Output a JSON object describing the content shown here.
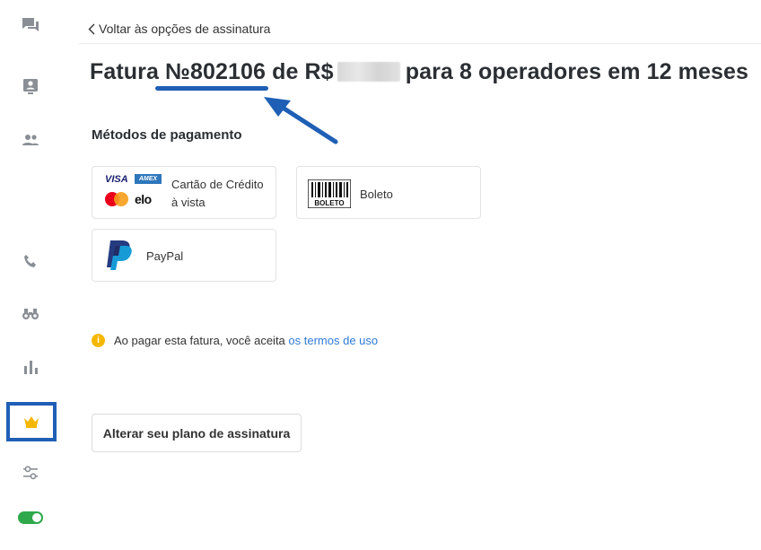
{
  "sidebar": {
    "items": [
      {
        "icon": "chat-icon"
      },
      {
        "icon": "contact-card-icon"
      },
      {
        "icon": "team-icon"
      },
      {
        "icon": "phone-icon"
      },
      {
        "icon": "binoculars-icon"
      },
      {
        "icon": "bar-chart-icon"
      },
      {
        "icon": "crown-icon",
        "active": true
      },
      {
        "icon": "sliders-icon"
      },
      {
        "icon": "toggle-icon",
        "state": "on"
      }
    ],
    "highlight_color": "#1f5fb5",
    "crown_color": "#f5b800",
    "toggle_color": "#2ea84a"
  },
  "header": {
    "back_label": "Voltar às opções de assinatura"
  },
  "invoice": {
    "title_prefix": "Fatura",
    "number": "№802106",
    "title_mid": "de R$",
    "title_suffix": "para 8 operadores em 12 meses"
  },
  "payment": {
    "section_title": "Métodos de pagamento",
    "methods": {
      "credit_card": {
        "label_line1": "Cartão de Crédito",
        "label_line2": "à vista",
        "brands": [
          "VISA",
          "AMEX",
          "elo"
        ]
      },
      "boleto": {
        "label": "Boleto",
        "logo_text": "BOLETO"
      },
      "paypal": {
        "label": "PayPal"
      }
    }
  },
  "notice": {
    "text": "Ao pagar esta fatura, você aceita",
    "link": "os termos de uso"
  },
  "actions": {
    "change_plan": "Alterar seu plano de assinatura"
  }
}
